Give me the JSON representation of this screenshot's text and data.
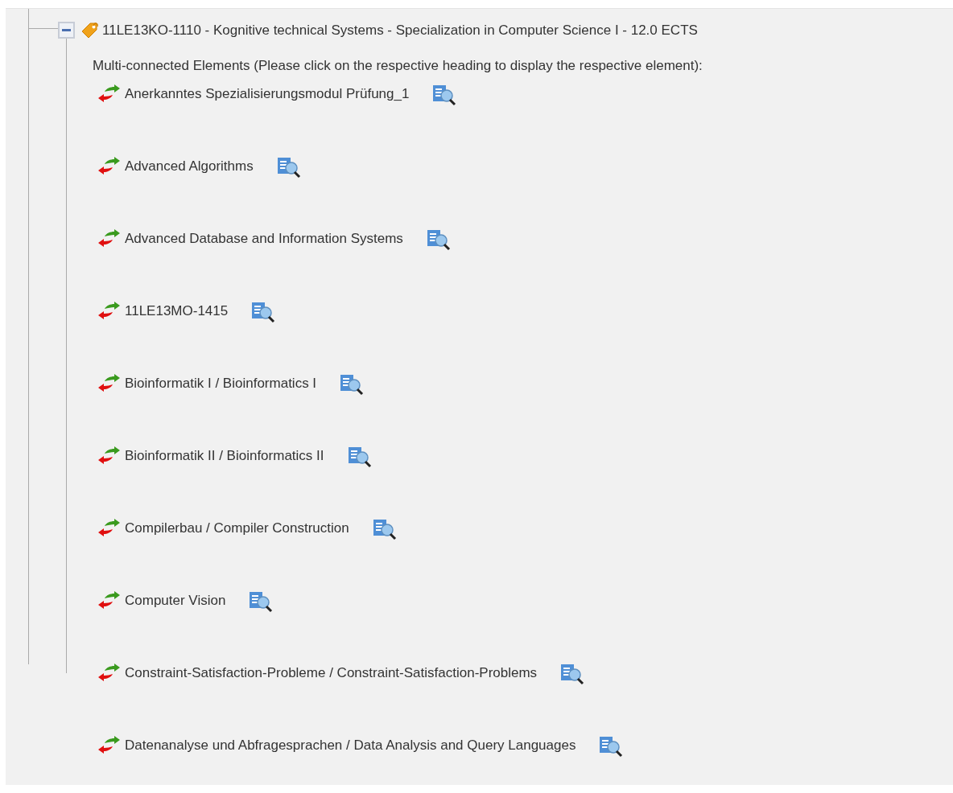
{
  "node": {
    "title": "11LE13KO-1110 - Kognitive technical Systems - Specialization in Computer Science I - 12.0 ECTS",
    "expanded": true,
    "intro": "Multi-connected Elements (Please click on the respective heading to display the respective element):",
    "elements": [
      {
        "label": "Anerkanntes Spezialisierungsmodul Prüfung_1"
      },
      {
        "label": "Advanced Algorithms"
      },
      {
        "label": "Advanced Database and Information Systems"
      },
      {
        "label": "11LE13MO-1415"
      },
      {
        "label": "Bioinformatik I / Bioinformatics I"
      },
      {
        "label": "Bioinformatik II / Bioinformatics II"
      },
      {
        "label": "Compilerbau / Compiler Construction"
      },
      {
        "label": "Computer Vision"
      },
      {
        "label": "Constraint-Satisfaction-Probleme / Constraint-Satisfaction-Problems"
      },
      {
        "label": "Datenanalyse und Abfragesprachen / Data Analysis and Query Languages"
      }
    ]
  }
}
